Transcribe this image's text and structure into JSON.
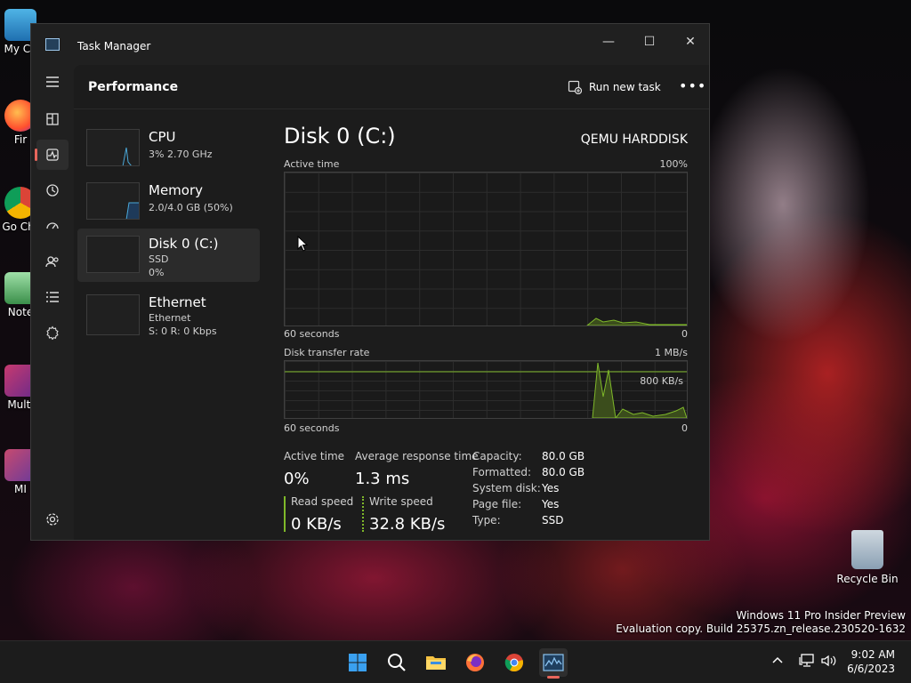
{
  "window": {
    "title": "Task Manager",
    "minimize": "—",
    "maximize": "☐",
    "close": "✕"
  },
  "header": {
    "title": "Performance",
    "run_new_task": "Run new task",
    "more": "•••"
  },
  "resources": [
    {
      "name": "CPU",
      "line1": "3% 2.70 GHz",
      "line2": ""
    },
    {
      "name": "Memory",
      "line1": "2.0/4.0 GB (50%)",
      "line2": ""
    },
    {
      "name": "Disk 0 (C:)",
      "line1": "SSD",
      "line2": "0%"
    },
    {
      "name": "Ethernet",
      "line1": "Ethernet",
      "line2": "S: 0 R: 0 Kbps"
    }
  ],
  "detail": {
    "title": "Disk 0 (C:)",
    "model": "QEMU HARDDISK",
    "graph1": {
      "label": "Active time",
      "max": "100%",
      "xlabel": "60 seconds",
      "min": "0"
    },
    "graph2": {
      "label": "Disk transfer rate",
      "max": "1 MB/s",
      "mid": "800 KB/s",
      "xlabel": "60 seconds",
      "min": "0"
    },
    "stats": {
      "active_time_label": "Active time",
      "active_time": "0%",
      "avg_resp_label": "Average response time",
      "avg_resp": "1.3 ms",
      "read_label": "Read speed",
      "read": "0 KB/s",
      "write_label": "Write speed",
      "write": "32.8 KB/s"
    },
    "props": [
      {
        "k": "Capacity:",
        "v": "80.0 GB"
      },
      {
        "k": "Formatted:",
        "v": "80.0 GB"
      },
      {
        "k": "System disk:",
        "v": "Yes"
      },
      {
        "k": "Page file:",
        "v": "Yes"
      },
      {
        "k": "Type:",
        "v": "SSD"
      }
    ]
  },
  "desktop": {
    "icons": [
      "My Co",
      "Fir",
      "Go Chr",
      "Note",
      "Multi",
      "MI"
    ],
    "recycle_bin": "Recycle Bin",
    "watermark_line1": "Windows 11 Pro Insider Preview",
    "watermark_line2": "Evaluation copy. Build 25375.zn_release.230520-1632"
  },
  "taskbar": {
    "time": "9:02 AM",
    "date": "6/6/2023"
  }
}
